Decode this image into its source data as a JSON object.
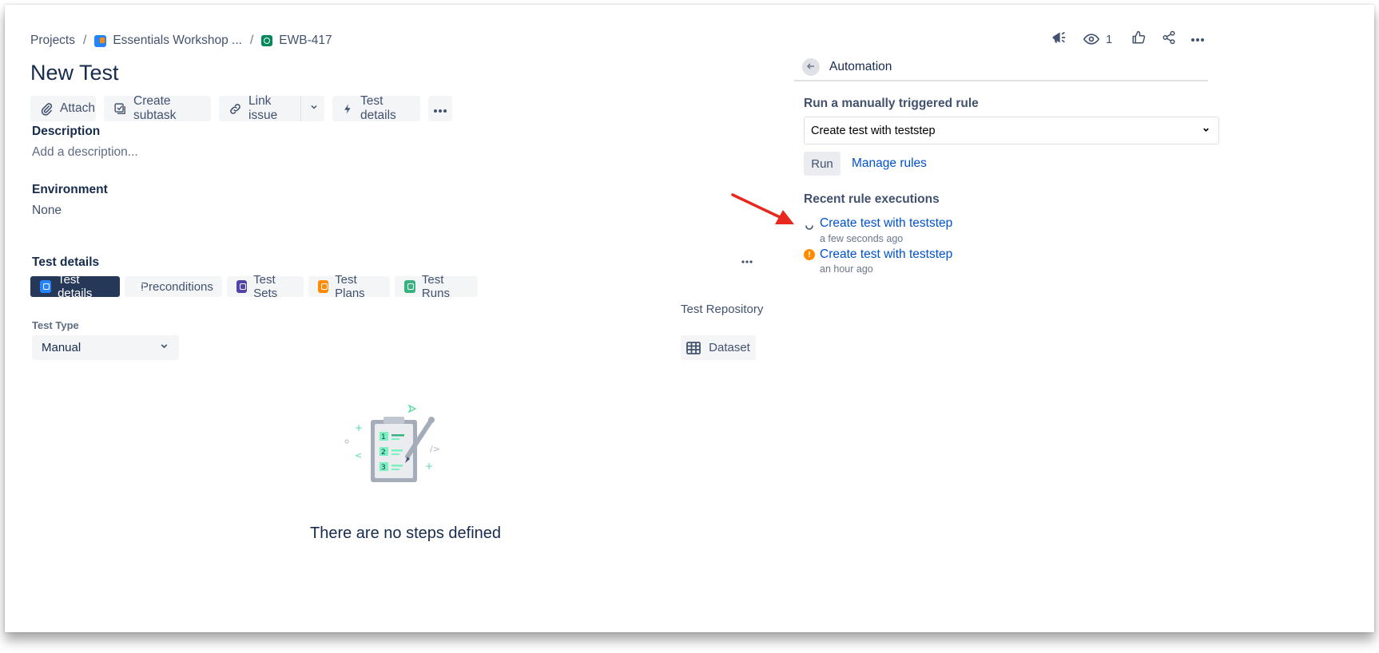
{
  "breadcrumb": {
    "projects": "Projects",
    "separator": "/",
    "project_name": "Essentials Workshop ...",
    "issue_key": "EWB-417"
  },
  "issue": {
    "title": "New Test"
  },
  "toolbar": {
    "attach": "Attach",
    "create_subtask": "Create subtask",
    "link_issue": "Link issue",
    "test_details": "Test details"
  },
  "description": {
    "label": "Description",
    "placeholder": "Add a description..."
  },
  "environment": {
    "label": "Environment",
    "value": "None"
  },
  "test_details_section": {
    "label": "Test details",
    "tabs": [
      {
        "label": "Test details",
        "icon": "list-icon",
        "color": "#2684ff",
        "active": true
      },
      {
        "label": "Preconditions",
        "icon": "precondition-icon",
        "color": "#00a3bf",
        "active": false
      },
      {
        "label": "Test Sets",
        "icon": "test-sets-icon",
        "color": "#5243aa",
        "active": false
      },
      {
        "label": "Test Plans",
        "icon": "test-plans-icon",
        "color": "#ff8b00",
        "active": false
      },
      {
        "label": "Test Runs",
        "icon": "test-runs-icon",
        "color": "#36b37e",
        "active": false
      }
    ],
    "test_repository": "Test Repository",
    "test_type_label": "Test Type",
    "test_type_value": "Manual",
    "dataset_button": "Dataset",
    "empty_state": "There are no steps defined"
  },
  "top_actions": {
    "watchers_count": "1"
  },
  "automation": {
    "header": "Automation",
    "run_rule_label": "Run a manually triggered rule",
    "selected_rule": "Create test with teststep",
    "run_button": "Run",
    "manage_rules": "Manage rules",
    "recent_label": "Recent rule executions",
    "executions": [
      {
        "name": "Create test with teststep",
        "time": "a few seconds ago",
        "status": "in-progress"
      },
      {
        "name": "Create test with teststep",
        "time": "an hour ago",
        "status": "warning"
      }
    ]
  },
  "colors": {
    "text": "#172b4d",
    "link": "#0052cc",
    "active_tab": "#253858",
    "button_bg": "#f4f5f7",
    "warning": "#ff8b00",
    "annotation_arrow": "#e8281e"
  }
}
